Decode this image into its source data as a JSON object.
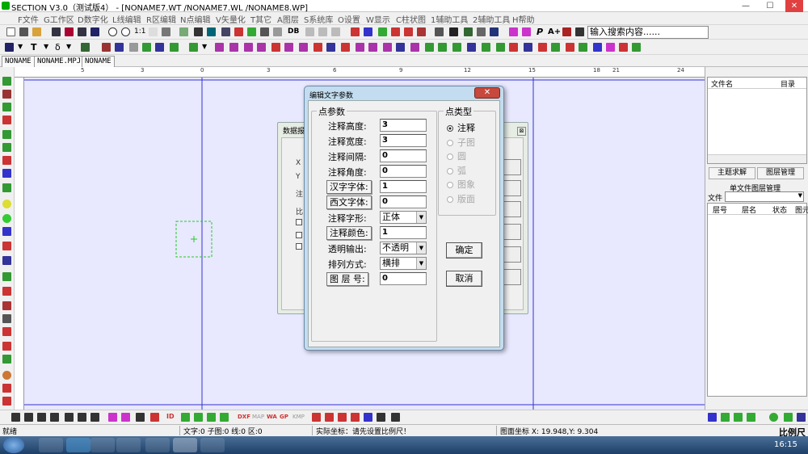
{
  "window": {
    "title": "SECTION V3.0（测试版4） - [NONAME7.WT /NONAME7.WL /NONAME8.WP]",
    "minimize": "—",
    "maximize": "☐",
    "close": "✕"
  },
  "menu": [
    "F文件",
    "G工作区",
    "D数字化",
    "L线编辑",
    "R区编辑",
    "N点编辑",
    "V矢量化",
    "T其它",
    "A图层",
    "S系统库",
    "O设置",
    "W显示",
    "C柱状图",
    "1辅助工具",
    "2辅助工具",
    "H帮助"
  ],
  "toolbar": {
    "scale_label": "1:1",
    "db_label": "DB",
    "a_plus": "A+",
    "p_label": "P",
    "search_value": "输入搜索内容......"
  },
  "doc_tabs": [
    "NONAME",
    "NONAME.MPJ",
    "NONAME"
  ],
  "ruler_numbers": [
    "5",
    "3",
    "0",
    "3",
    "6",
    "9",
    "12",
    "15",
    "18",
    "21",
    "24"
  ],
  "right_panel": {
    "col_file": "文件名",
    "col_dir": "目录",
    "btn_topic": "主题求解",
    "btn_layer_mgr": "图层管理",
    "single_layer_title": "单文件图层管理",
    "file_label": "文件",
    "layer_cols": [
      "层号",
      "层名",
      "状态",
      "图元"
    ]
  },
  "back_dialog": {
    "title": "数据报",
    "x_label": "X",
    "y_label": "Y",
    "note_label": "注",
    "ratio_label": "比"
  },
  "dialog": {
    "title": "编辑文字参数",
    "close": "✕",
    "group_points": "点参数",
    "fields": [
      {
        "label": "注释高度:",
        "value": "3",
        "type": "text"
      },
      {
        "label": "注释宽度:",
        "value": "3",
        "type": "text"
      },
      {
        "label": "注释间隔:",
        "value": "0",
        "type": "text"
      },
      {
        "label": "注释角度:",
        "value": "0",
        "type": "text"
      },
      {
        "label": "汉字字体:",
        "value": "1",
        "type": "button"
      },
      {
        "label": "西文字体:",
        "value": "0",
        "type": "button"
      },
      {
        "label": "注释字形:",
        "value": "正体",
        "type": "select"
      },
      {
        "label": "注释颜色:",
        "value": "1",
        "type": "button"
      },
      {
        "label": "透明输出:",
        "value": "不透明",
        "type": "select"
      },
      {
        "label": "排列方式:",
        "value": "横排",
        "type": "select"
      },
      {
        "label": "图 层 号:",
        "value": "0",
        "type": "button"
      }
    ],
    "group_type": "点类型",
    "point_types": [
      {
        "label": "注释",
        "checked": true
      },
      {
        "label": "子图",
        "checked": false
      },
      {
        "label": "圆",
        "checked": false
      },
      {
        "label": "弧",
        "checked": false
      },
      {
        "label": "图象",
        "checked": false
      },
      {
        "label": "版面",
        "checked": false
      }
    ],
    "ok": "确定",
    "cancel": "取消"
  },
  "status": {
    "ready": "就绪",
    "counts": "文字:0 子图:0 线:0 区:0",
    "real_coords": "实际坐标：请先设置比例尺！",
    "map_coords": "图面坐标 X:  19.948,Y:  9.304",
    "scale": "比例尺"
  },
  "taskbar": {
    "time": "16:15"
  },
  "colors": {
    "canvas": "#e8e8ff",
    "dialog_frame": "#c3dcef",
    "close_red": "#c7483c",
    "selection_green": "#22cc22",
    "guide_blue": "#3333cc"
  }
}
